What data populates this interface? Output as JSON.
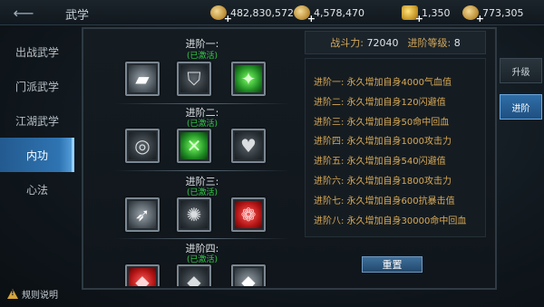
{
  "header": {
    "title": "武学"
  },
  "resources": [
    {
      "icon": "coin-icon",
      "value": "482,830,572"
    },
    {
      "icon": "ingot-icon",
      "value": "4,578,470"
    },
    {
      "icon": "token-icon",
      "value": "1,350"
    },
    {
      "icon": "gold-ingot-icon",
      "value": "773,305"
    }
  ],
  "nav": {
    "items": [
      {
        "label": "出战武学"
      },
      {
        "label": "门派武学"
      },
      {
        "label": "江湖武学"
      },
      {
        "label": "内功"
      },
      {
        "label": "心法"
      }
    ]
  },
  "rules_label": "规则说明",
  "tree": {
    "stages": [
      {
        "title": "进阶一:",
        "status": "(已激活)"
      },
      {
        "title": "进阶二:",
        "status": "(已激活)"
      },
      {
        "title": "进阶三:",
        "status": "(已激活)"
      },
      {
        "title": "进阶四:",
        "status": "(已激活)"
      }
    ]
  },
  "stats": {
    "power_label": "战斗力:",
    "power_value": "72040",
    "level_label": "进阶等级:",
    "level_value": "8"
  },
  "effects": [
    "进阶一: 永久增加自身4000气血值",
    "进阶二: 永久增加自身120闪避值",
    "进阶三: 永久增加自身50命中回血",
    "进阶四: 永久增加自身1000攻击力",
    "进阶五: 永久增加自身540闪避值",
    "进阶六: 永久增加自身1800攻击力",
    "进阶七: 永久增加自身600抗暴击值",
    "进阶八: 永久增加自身30000命中回血"
  ],
  "reset_label": "重置",
  "tabs": {
    "upgrade": "升级",
    "advance": "进阶"
  }
}
